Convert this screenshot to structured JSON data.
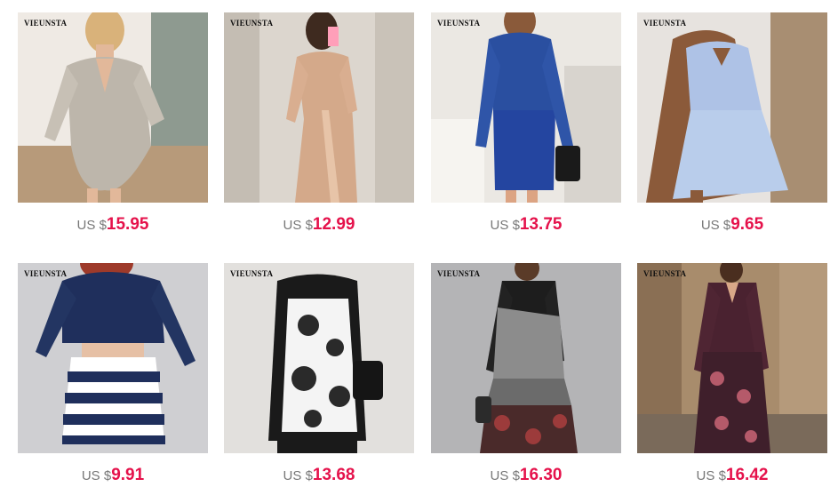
{
  "products": [
    {
      "brand": "VIEUNSTA",
      "currency": "US",
      "symbol": "$",
      "price": "15.95",
      "image": "sequin-wrap-mini-dress"
    },
    {
      "brand": "VIEUNSTA",
      "currency": "US",
      "symbol": "$",
      "price": "12.99",
      "image": "champagne-slit-maxi-dress"
    },
    {
      "brand": "VIEUNSTA",
      "currency": "US",
      "symbol": "$",
      "price": "13.75",
      "image": "blue-satin-ruched-dress"
    },
    {
      "brand": "VIEUNSTA",
      "currency": "US",
      "symbol": "$",
      "price": "9.65",
      "image": "blue-floral-slip-dress"
    },
    {
      "brand": "VIEUNSTA",
      "currency": "US",
      "symbol": "$",
      "price": "9.91",
      "image": "navy-stripe-two-piece-set"
    },
    {
      "brand": "VIEUNSTA",
      "currency": "US",
      "symbol": "$",
      "price": "13.68",
      "image": "black-white-print-dress"
    },
    {
      "brand": "VIEUNSTA",
      "currency": "US",
      "symbol": "$",
      "price": "16.30",
      "image": "patchwork-maxi-dress"
    },
    {
      "brand": "VIEUNSTA",
      "currency": "US",
      "symbol": "$",
      "price": "16.42",
      "image": "floral-vneck-maxi-dress"
    }
  ]
}
